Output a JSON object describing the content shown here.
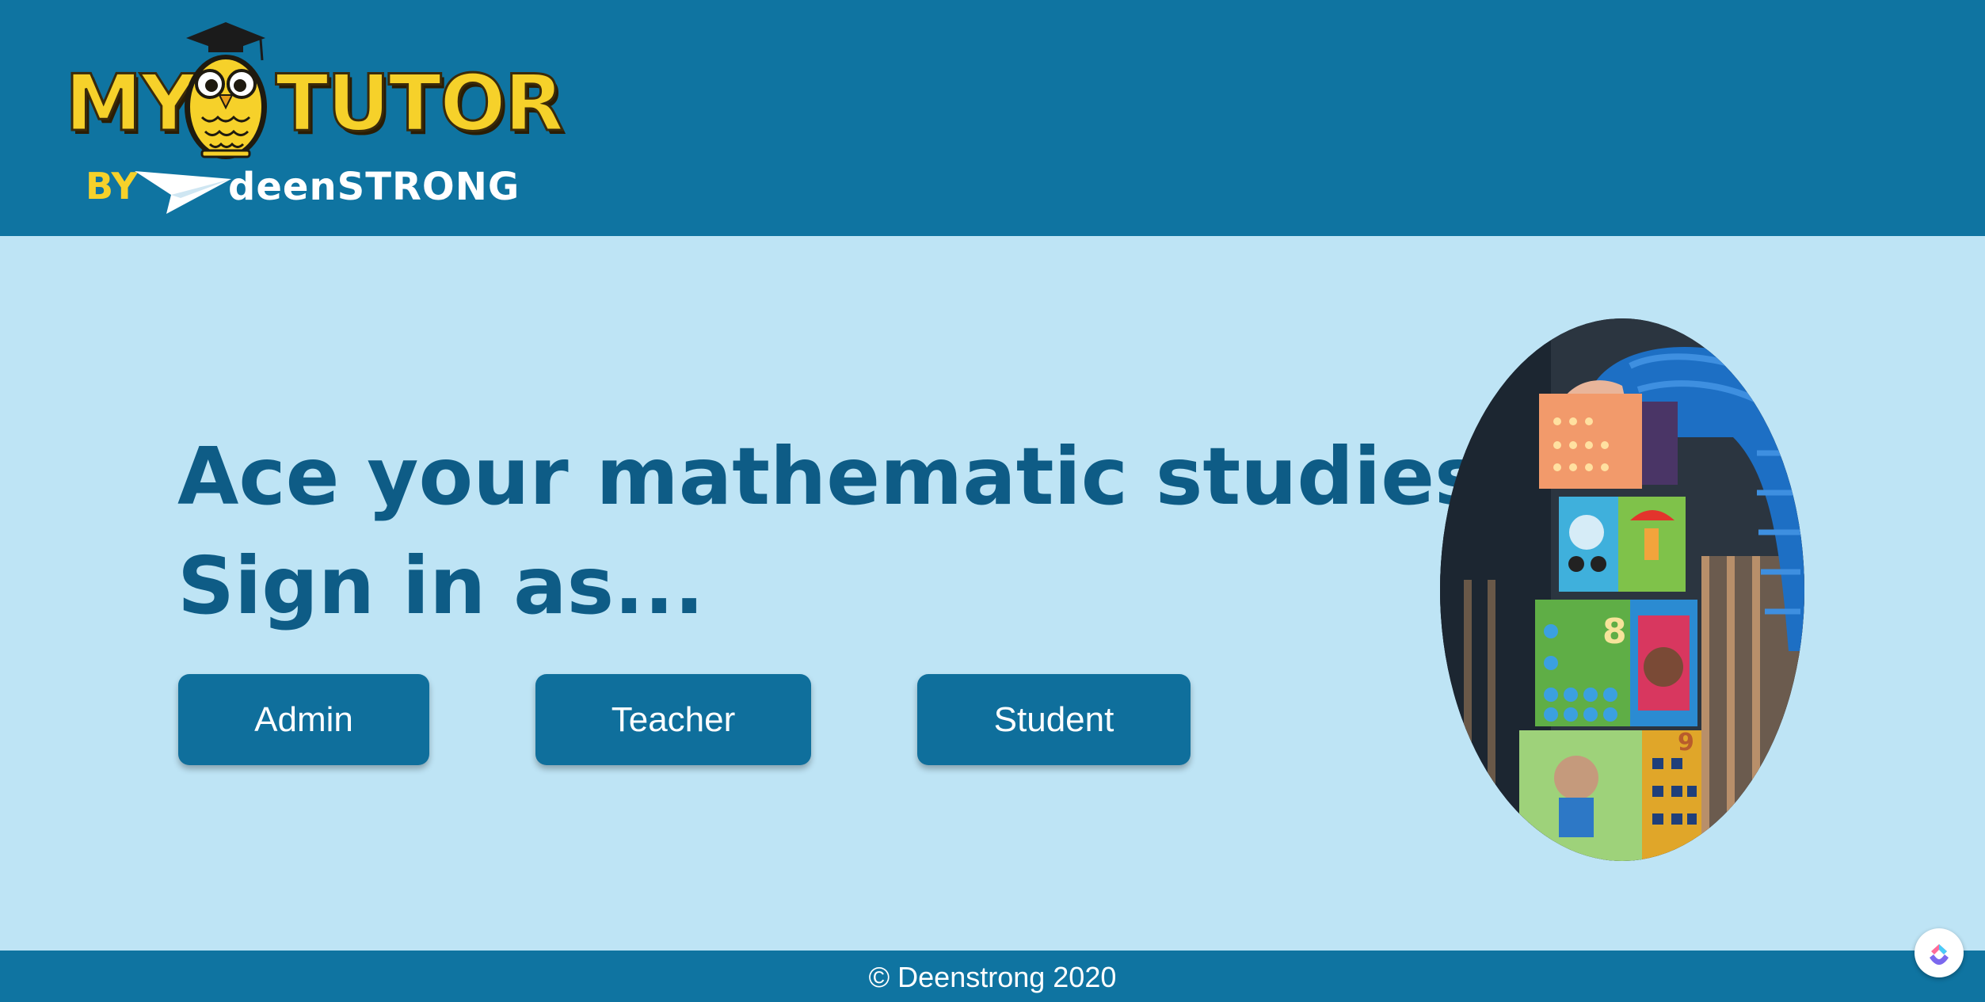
{
  "header": {
    "logo": {
      "word_left": "MY",
      "word_right": "TUTOR",
      "by_text": "BY",
      "brand_text": "deenSTRONG",
      "icon": "owl-graduate-icon"
    }
  },
  "main": {
    "headline_line1": "Ace your mathematic studies",
    "headline_line2": "Sign in as...",
    "buttons": [
      {
        "label": "Admin"
      },
      {
        "label": "Teacher"
      },
      {
        "label": "Student"
      }
    ],
    "hero_image": "child-stacking-toy-blocks-photo"
  },
  "footer": {
    "copyright": "© Deenstrong 2020"
  },
  "widgets": {
    "help_icon": "clickup-logo-icon"
  },
  "colors": {
    "header_bg": "#0f74a1",
    "page_bg": "#bee4f5",
    "headline": "#0e5c86",
    "button_bg": "#0f6f9c",
    "logo_yellow": "#f6d12a"
  }
}
